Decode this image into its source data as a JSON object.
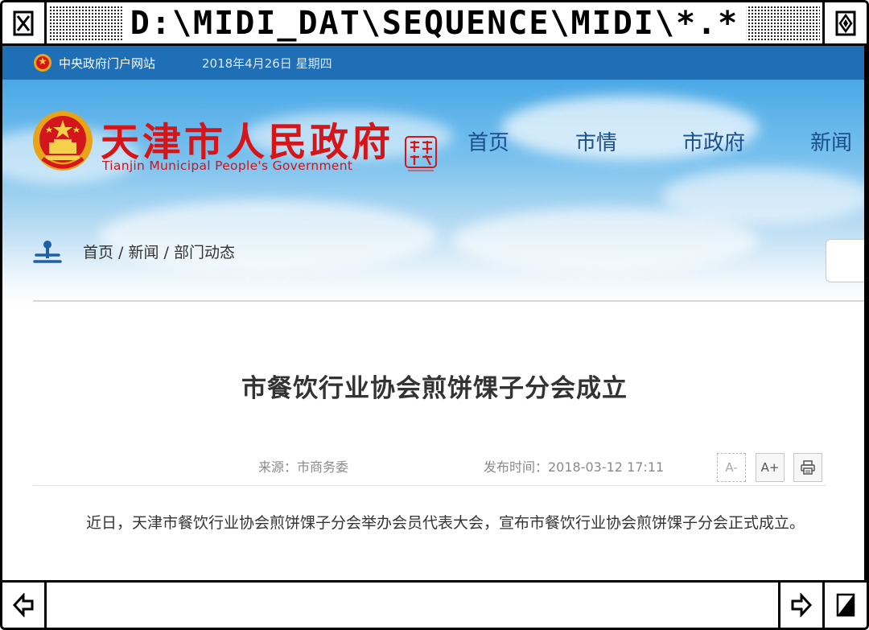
{
  "window": {
    "title": "D:\\MIDI_DAT\\SEQUENCE\\MIDI\\*.*",
    "close_icon": "close-box-icon",
    "zoom_icon": "zoom-box-icon"
  },
  "topbar": {
    "portal_label": "中央政府门户网站",
    "date": "2018年4月26日 星期四",
    "bg_color": "#1e6fb6"
  },
  "header": {
    "title": "天津市人民政府",
    "subtitle": "Tianjin Municipal People's Government",
    "title_color": "#d61518",
    "nav": [
      "首页",
      "市情",
      "市政府",
      "新闻"
    ]
  },
  "breadcrumb": {
    "items": [
      "首页",
      "新闻",
      "部门动态"
    ],
    "separator": " / "
  },
  "article": {
    "title": "市餐饮行业协会煎饼馃子分会成立",
    "source": "来源：市商务委",
    "publish_time": "发布时间：2018-03-12 17:11",
    "tools": {
      "font_decrease": "A-",
      "font_increase": "A+",
      "print_icon": "print-icon"
    },
    "body": "近日，天津市餐饮行业协会煎饼馃子分会举办会员代表大会，宣布市餐饮行业协会煎饼馃子分会正式成立。"
  }
}
